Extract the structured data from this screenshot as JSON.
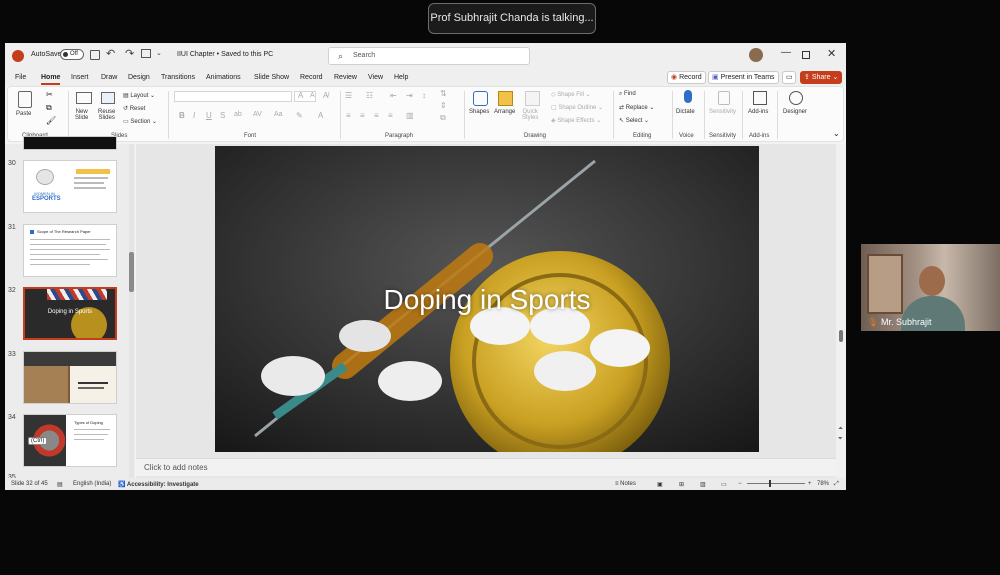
{
  "meeting": {
    "speaking_banner": "Prof Subhrajit Chanda is talking..."
  },
  "titlebar": {
    "autosave_label": "AutoSave",
    "autosave_state": "Off",
    "doc_title": "IIUI Chapter • Saved to this PC",
    "search_placeholder": "Search"
  },
  "menu": {
    "items": [
      "File",
      "Home",
      "Insert",
      "Draw",
      "Design",
      "Transitions",
      "Animations",
      "Slide Show",
      "Record",
      "Review",
      "View",
      "Help"
    ],
    "active": "Home",
    "record_button": "Record",
    "present_teams_button": "Present in Teams",
    "share_button": "Share"
  },
  "ribbon": {
    "clipboard": {
      "paste": "Paste",
      "group": "Clipboard"
    },
    "slides": {
      "new_slide_1": "New",
      "new_slide_2": "Slide",
      "reuse_1": "Reuse",
      "reuse_2": "Slides",
      "layout": "Layout",
      "reset": "Reset",
      "section": "Section",
      "group": "Slides"
    },
    "font": {
      "group": "Font"
    },
    "paragraph": {
      "group": "Paragraph"
    },
    "drawing": {
      "shapes": "Shapes",
      "arrange": "Arrange",
      "quick_styles_1": "Quick",
      "quick_styles_2": "Styles",
      "shape_fill": "Shape Fill",
      "shape_outline": "Shape Outline",
      "shape_effects": "Shape Effects",
      "group": "Drawing"
    },
    "editing": {
      "find": "Find",
      "replace": "Replace",
      "select": "Select",
      "group": "Editing"
    },
    "voice": {
      "dictate": "Dictate",
      "group": "Voice"
    },
    "sensitivity": {
      "label": "Sensitivity",
      "group": "Sensitivity"
    },
    "addins": {
      "label": "Add-ins",
      "group": "Add-ins"
    },
    "designer": {
      "label": "Designer"
    }
  },
  "slides_panel": {
    "thumbnails": [
      {
        "number": "30",
        "line1": "WOMEN IN",
        "line2": "ESPORTS"
      },
      {
        "number": "31",
        "line1": "Scope of The Research Paper"
      },
      {
        "number": "32",
        "line1": "Doping in Sports"
      },
      {
        "number": "33",
        "line1": ""
      },
      {
        "number": "34",
        "line1": "Types of Doping",
        "badge": "(Ctrl)"
      }
    ],
    "partial_number": "35"
  },
  "slide": {
    "title": "Doping in Sports"
  },
  "notes": {
    "placeholder": "Click to add notes"
  },
  "status": {
    "slide_counter": "Slide 32 of 45",
    "language": "English (India)",
    "accessibility": "Accessibility: Investigate",
    "notes_button": "Notes",
    "zoom": "78%"
  },
  "participant": {
    "name": "Mr. Subhrajit"
  }
}
